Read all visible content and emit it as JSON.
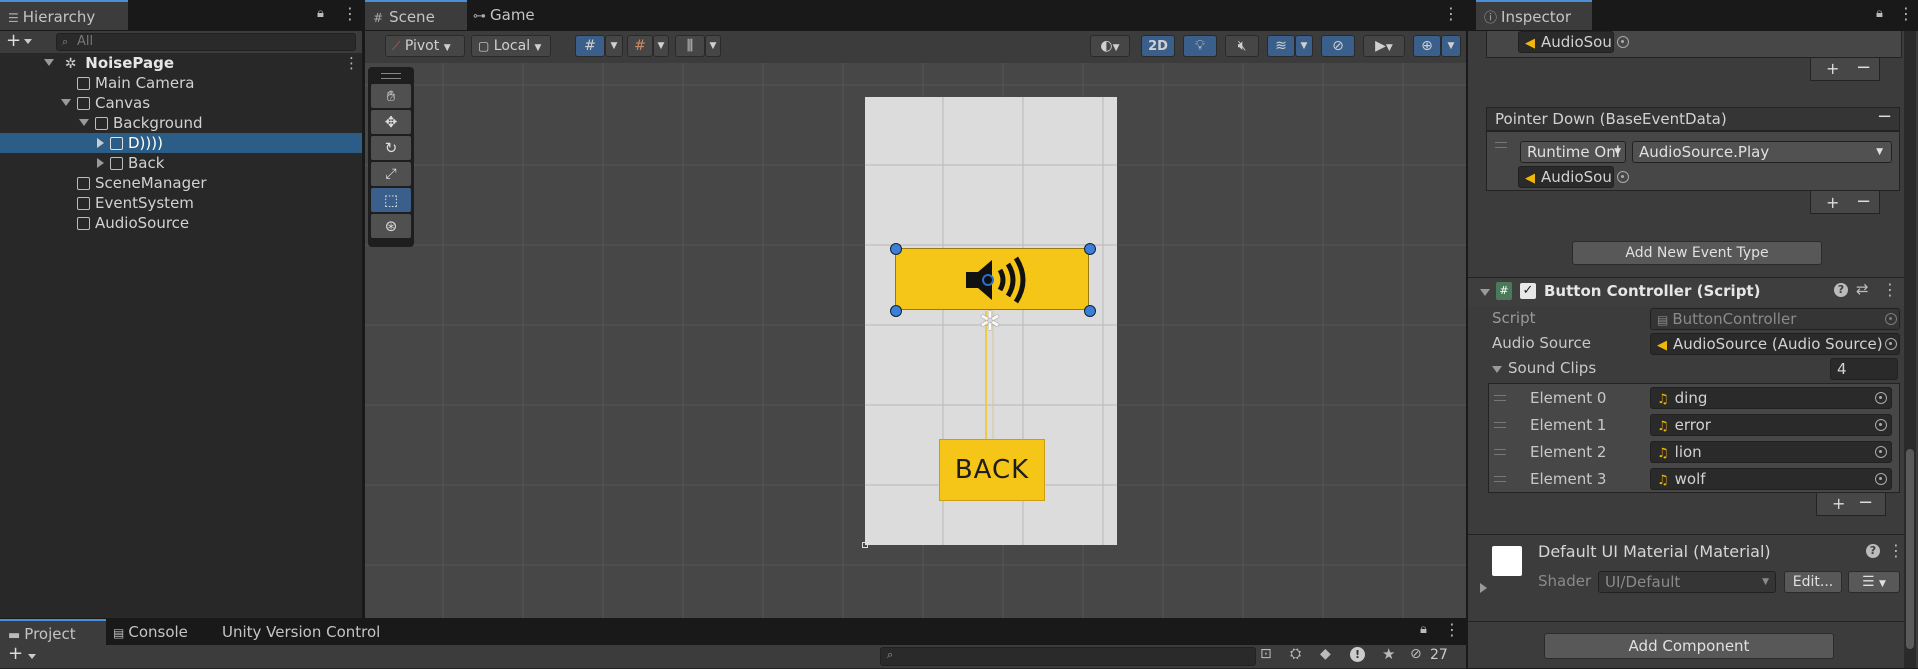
{
  "hierarchy": {
    "tab_label": "Hierarchy",
    "search_placeholder": "All",
    "scene_name": "NoisePage",
    "items": [
      {
        "label": "Main Camera"
      },
      {
        "label": "Canvas"
      },
      {
        "label": "Background"
      },
      {
        "label": "D))))"
      },
      {
        "label": "Back"
      },
      {
        "label": "SceneManager"
      },
      {
        "label": "EventSystem"
      },
      {
        "label": "AudioSource"
      }
    ]
  },
  "scene": {
    "tabs": [
      {
        "label": "Scene"
      },
      {
        "label": "Game"
      }
    ],
    "pivot_label": "Pivot",
    "local_label": "Local",
    "mode_2d_label": "2D",
    "back_button_text": "BACK"
  },
  "inspector": {
    "tab_label": "Inspector",
    "top_object_label": "AudioSou",
    "pointer_down_label": "Pointer Down (BaseEventData)",
    "runtime_label": "Runtime Onl",
    "function_label": "AudioSource.Play",
    "object_label": "AudioSou",
    "add_event_type_label": "Add New Event Type",
    "component_title": "Button Controller (Script)",
    "script_label": "Script",
    "script_value": "ButtonController",
    "audio_source_label": "Audio Source",
    "audio_source_value": "AudioSource (Audio Source)",
    "sound_clips_label": "Sound Clips",
    "sound_clips_count": "4",
    "elements": [
      {
        "label": "Element 0",
        "value": "ding"
      },
      {
        "label": "Element 1",
        "value": "error"
      },
      {
        "label": "Element 2",
        "value": "lion"
      },
      {
        "label": "Element 3",
        "value": "wolf"
      }
    ],
    "material_title": "Default UI Material (Material)",
    "shader_label": "Shader",
    "shader_value": "UI/Default",
    "edit_label": "Edit...",
    "add_component_label": "Add Component"
  },
  "bottom": {
    "tabs": [
      {
        "label": "Project"
      },
      {
        "label": "Console"
      },
      {
        "label": "Unity Version Control"
      }
    ],
    "hidden_count": "27"
  },
  "colors": {
    "accent_blue": "#4d8ed9",
    "selection": "#2c5d87",
    "yellow": "#f5c518"
  }
}
